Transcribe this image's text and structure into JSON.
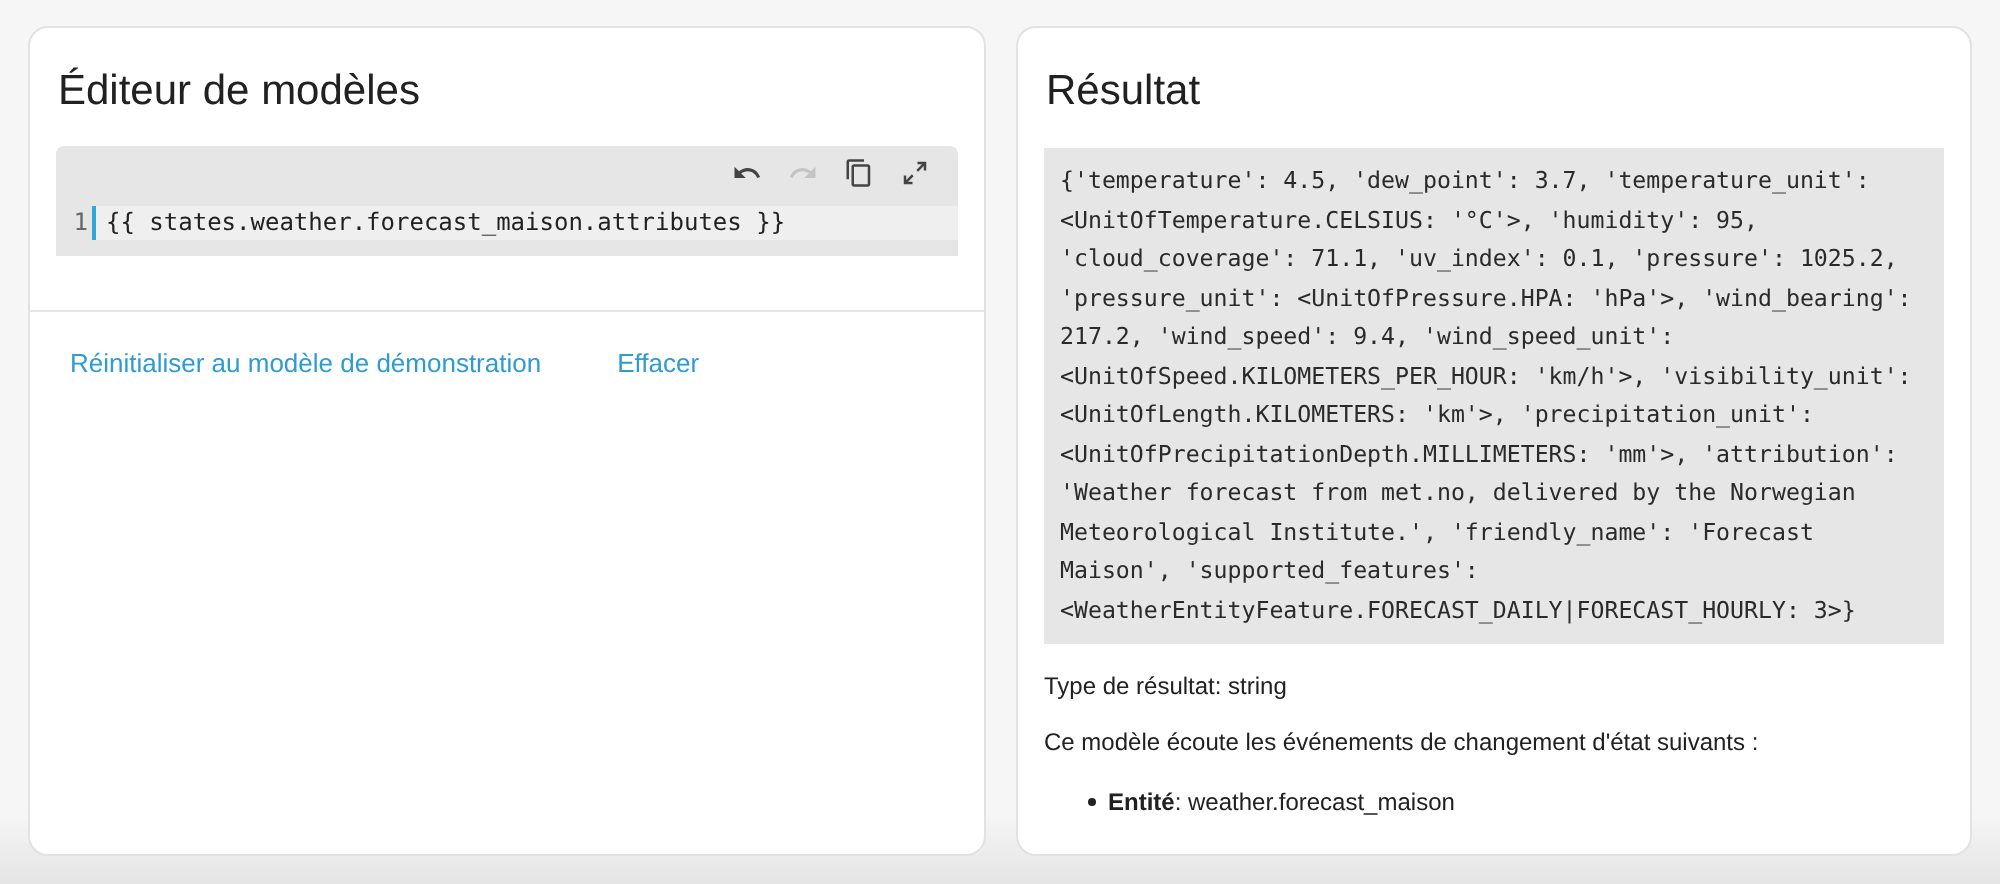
{
  "editor": {
    "title": "Éditeur de modèles",
    "toolbar": [
      {
        "kind": "undo",
        "disabled": false
      },
      {
        "kind": "redo",
        "disabled": true
      },
      {
        "kind": "copy",
        "disabled": false
      },
      {
        "kind": "expand",
        "disabled": false
      }
    ],
    "lines": [
      {
        "number": "1",
        "code": "{{ states.weather.forecast_maison.attributes }}"
      }
    ],
    "actions": [
      "Réinitialiser au modèle de démonstration",
      "Effacer"
    ]
  },
  "result": {
    "title": "Résultat",
    "output_lines": [
      "{'temperature': 4.5, 'dew_point': 3.7, 'temperature_unit':",
      "<UnitOfTemperature.CELSIUS: '°C'>, 'humidity': 95,",
      "'cloud_coverage': 71.1, 'uv_index': 0.1, 'pressure': 1025.2,",
      "'pressure_unit': <UnitOfPressure.HPA: 'hPa'>, 'wind_bearing':",
      "217.2, 'wind_speed': 9.4, 'wind_speed_unit':",
      "<UnitOfSpeed.KILOMETERS_PER_HOUR: 'km/h'>, 'visibility_unit':",
      "<UnitOfLength.KILOMETERS: 'km'>, 'precipitation_unit':",
      "<UnitOfPrecipitationDepth.MILLIMETERS: 'mm'>, 'attribution':",
      "'Weather forecast from met.no, delivered by the Norwegian",
      "Meteorological Institute.', 'friendly_name': 'Forecast",
      "Maison', 'supported_features':",
      "<WeatherEntityFeature.FORECAST_DAILY|FORECAST_HOURLY: 3>}"
    ],
    "type_text": "Type de résultat: string",
    "listen_text": "Ce modèle écoute les événements de changement d'état suivants :",
    "listeners": [
      "**Entité**: weather.forecast_maison"
    ]
  }
}
